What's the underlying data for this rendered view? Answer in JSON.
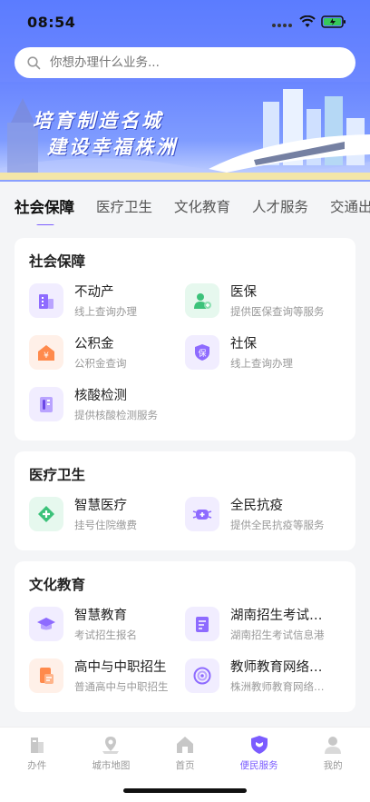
{
  "status_bar": {
    "time": "08:54"
  },
  "search": {
    "placeholder": "你想办理什么业务..."
  },
  "banner": {
    "line1": "培育制造名城",
    "line2": "建设幸福株洲"
  },
  "tabs": [
    {
      "label": "社会保障"
    },
    {
      "label": "医疗卫生"
    },
    {
      "label": "文化教育"
    },
    {
      "label": "人才服务"
    },
    {
      "label": "交通出行"
    }
  ],
  "sections": {
    "social": {
      "title": "社会保障",
      "items": [
        {
          "name": "不动产",
          "desc": "线上查询办理",
          "icon": "building-icon"
        },
        {
          "name": "医保",
          "desc": "提供医保查询等服务",
          "icon": "medical-insurance-icon"
        },
        {
          "name": "公积金",
          "desc": "公积金查询",
          "icon": "housing-fund-icon"
        },
        {
          "name": "社保",
          "desc": "线上查询办理",
          "icon": "shield-icon"
        },
        {
          "name": "核酸检测",
          "desc": "提供核酸检测服务",
          "icon": "test-tube-icon"
        }
      ]
    },
    "medical": {
      "title": "医疗卫生",
      "items": [
        {
          "name": "智慧医疗",
          "desc": "挂号住院缴费",
          "icon": "smart-medical-icon"
        },
        {
          "name": "全民抗疫",
          "desc": "提供全民抗疫等服务",
          "icon": "mask-icon"
        }
      ]
    },
    "education": {
      "title": "文化教育",
      "items": [
        {
          "name": "智慧教育",
          "desc": "考试招生报名",
          "icon": "graduation-cap-icon"
        },
        {
          "name": "湖南招生考试信息港",
          "desc": "湖南招生考试信息港",
          "icon": "exam-book-icon"
        },
        {
          "name": "高中与中职招生",
          "desc": "普通高中与中职招生",
          "icon": "document-icon"
        },
        {
          "name": "教师教育网络学院",
          "desc": "株洲教师教育网络学院",
          "icon": "network-icon"
        }
      ]
    }
  },
  "bottom_nav": [
    {
      "label": "办件",
      "icon": "files-icon"
    },
    {
      "label": "城市地图",
      "icon": "map-icon"
    },
    {
      "label": "首页",
      "icon": "home-icon"
    },
    {
      "label": "便民服务",
      "icon": "service-shield-icon"
    },
    {
      "label": "我的",
      "icon": "user-icon"
    }
  ],
  "colors": {
    "accent": "#7b5cff",
    "header": "#5b7cff"
  }
}
